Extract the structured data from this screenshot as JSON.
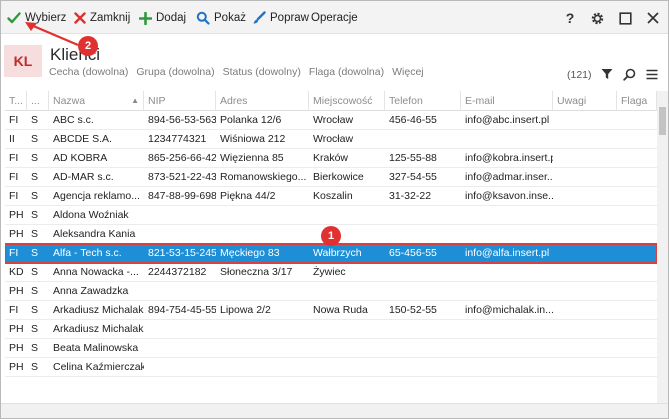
{
  "toolbar": {
    "select_label": "Wybierz",
    "close_label": "Zamknij",
    "add_label": "Dodaj",
    "show_label": "Pokaż",
    "edit_label": "Popraw",
    "operations_label": "Operacje",
    "help_label": "?"
  },
  "header": {
    "logo_text": "KL",
    "title": "Klienci",
    "filters": [
      "Cecha (dowolna)",
      "Grupa (dowolna)",
      "Status (dowolny)",
      "Flaga (dowolna)",
      "Więcej"
    ],
    "count": "(121)"
  },
  "columns": [
    "T...",
    "...",
    "Nazwa",
    "NIP",
    "Adres",
    "Miejscowość",
    "Telefon",
    "E-mail",
    "Uwagi",
    "Flaga"
  ],
  "rows": [
    [
      "FI",
      "S",
      "ABC s.c.",
      "894-56-53-563",
      "Polanka 12/6",
      "Wrocław",
      "456-46-55",
      "info@abc.insert.pl",
      "",
      ""
    ],
    [
      "II",
      "S",
      "ABCDE S.A.",
      "1234774321",
      "Wiśniowa 212",
      "Wrocław",
      "",
      "",
      "",
      ""
    ],
    [
      "FI",
      "S",
      "AD KOBRA",
      "865-256-66-42",
      "Więzienna 85",
      "Kraków",
      "125-55-88",
      "info@kobra.insert.pl",
      "",
      ""
    ],
    [
      "FI",
      "S",
      "AD-MAR s.c.",
      "873-521-22-43",
      "Romanowskiego...",
      "Bierkowice",
      "327-54-55",
      "info@admar.inser...",
      "",
      ""
    ],
    [
      "FI",
      "S",
      "Agencja reklamo...",
      "847-88-99-698",
      "Piękna 44/2",
      "Koszalin",
      "31-32-22",
      "info@ksavon.inse...",
      "",
      ""
    ],
    [
      "PH",
      "S",
      "Aldona Woźniak",
      "",
      "",
      "",
      "",
      "",
      "",
      ""
    ],
    [
      "PH",
      "S",
      "Aleksandra Kania",
      "",
      "",
      "",
      "",
      "",
      "",
      ""
    ],
    [
      "FI",
      "S",
      "Alfa - Tech s.c.",
      "821-53-15-245",
      "Męckiego 83",
      "Wałbrzych",
      "65-456-55",
      "info@alfa.insert.pl",
      "",
      ""
    ],
    [
      "KD",
      "S",
      "Anna Nowacka -...",
      "2244372182",
      "Słoneczna 3/17",
      "Żywiec",
      "",
      "",
      "",
      ""
    ],
    [
      "PH",
      "S",
      "Anna Zawadzka",
      "",
      "",
      "",
      "",
      "",
      "",
      ""
    ],
    [
      "FI",
      "S",
      "Arkadiusz Michalak",
      "894-754-45-55",
      "Lipowa 2/2",
      "Nowa Ruda",
      "150-52-55",
      "info@michalak.in...",
      "",
      ""
    ],
    [
      "PH",
      "S",
      "Arkadiusz Michalak",
      "",
      "",
      "",
      "",
      "",
      "",
      ""
    ],
    [
      "PH",
      "S",
      "Beata Malinowska",
      "",
      "",
      "",
      "",
      "",
      "",
      ""
    ],
    [
      "PH",
      "S",
      "Celina Kaźmierczak",
      "",
      "",
      "",
      "",
      "",
      "",
      ""
    ]
  ],
  "selected_row": 7,
  "annotations": [
    "1",
    "2"
  ],
  "colors": {
    "accent": "#1e8fd6",
    "annotation": "#e0302f",
    "check": "#2e9a3c",
    "close": "#d9322d"
  },
  "icons": [
    "check-icon",
    "x-icon",
    "plus-icon",
    "search-icon",
    "brush-icon",
    "help-icon",
    "gear-icon",
    "maximize-icon",
    "close-icon",
    "filter-icon",
    "menu-icon"
  ]
}
